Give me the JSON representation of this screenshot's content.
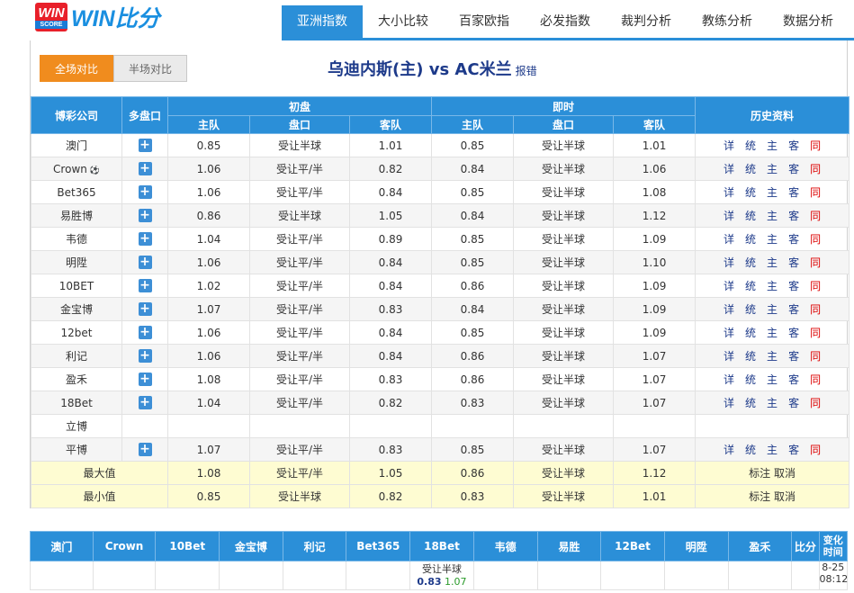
{
  "logo": {
    "box_top": "WIN",
    "box_bottom": "SCORE",
    "text": "WIN比分"
  },
  "nav": {
    "items": [
      "亚洲指数",
      "大小比较",
      "百家欧指",
      "必发指数",
      "裁判分析",
      "教练分析",
      "数据分析"
    ],
    "active_index": 0
  },
  "toggle": {
    "full": "全场对比",
    "half": "半场对比"
  },
  "match": {
    "title": "乌迪内斯(主) vs AC米兰",
    "report": "报错"
  },
  "table": {
    "headers": {
      "company": "博彩公司",
      "multi": "多盘口",
      "initial": "初盘",
      "live": "即时",
      "history": "历史资料",
      "home": "主队",
      "line": "盘口",
      "away": "客队"
    },
    "history_links": [
      "详",
      "统",
      "主",
      "客",
      "同"
    ],
    "rows": [
      {
        "company": "澳门",
        "plus": true,
        "i_home": "0.85",
        "i_line": "受让半球",
        "i_away": "1.01",
        "l_home": "0.85",
        "l_line": "受让半球",
        "l_away": "1.01"
      },
      {
        "company": "Crown",
        "soccer": true,
        "plus": true,
        "i_home": "1.06",
        "i_line": "受让平/半",
        "i_away": "0.82",
        "l_home": "0.84",
        "l_line": "受让半球",
        "l_away": "1.06"
      },
      {
        "company": "Bet365",
        "plus": true,
        "i_home": "1.06",
        "i_line": "受让平/半",
        "i_away": "0.84",
        "l_home": "0.85",
        "l_line": "受让半球",
        "l_away": "1.08"
      },
      {
        "company": "易胜博",
        "plus": true,
        "i_home": "0.86",
        "i_line": "受让半球",
        "i_away": "1.05",
        "l_home": "0.84",
        "l_line": "受让半球",
        "l_away": "1.12"
      },
      {
        "company": "韦德",
        "plus": true,
        "i_home": "1.04",
        "i_line": "受让平/半",
        "i_away": "0.89",
        "l_home": "0.85",
        "l_line": "受让半球",
        "l_away": "1.09"
      },
      {
        "company": "明陞",
        "plus": true,
        "i_home": "1.06",
        "i_line": "受让平/半",
        "i_away": "0.84",
        "l_home": "0.85",
        "l_line": "受让半球",
        "l_away": "1.10"
      },
      {
        "company": "10BET",
        "plus": true,
        "i_home": "1.02",
        "i_line": "受让平/半",
        "i_away": "0.84",
        "l_home": "0.86",
        "l_line": "受让半球",
        "l_away": "1.09"
      },
      {
        "company": "金宝博",
        "plus": true,
        "i_home": "1.07",
        "i_line": "受让平/半",
        "i_away": "0.83",
        "l_home": "0.84",
        "l_line": "受让半球",
        "l_away": "1.09"
      },
      {
        "company": "12bet",
        "plus": true,
        "i_home": "1.06",
        "i_line": "受让平/半",
        "i_away": "0.84",
        "l_home": "0.85",
        "l_line": "受让半球",
        "l_away": "1.09"
      },
      {
        "company": "利记",
        "plus": true,
        "i_home": "1.06",
        "i_line": "受让平/半",
        "i_away": "0.84",
        "l_home": "0.86",
        "l_line": "受让半球",
        "l_away": "1.07"
      },
      {
        "company": "盈禾",
        "plus": true,
        "i_home": "1.08",
        "i_line": "受让平/半",
        "i_away": "0.83",
        "l_home": "0.86",
        "l_line": "受让半球",
        "l_away": "1.07"
      },
      {
        "company": "18Bet",
        "plus": true,
        "i_home": "1.04",
        "i_line": "受让平/半",
        "i_away": "0.82",
        "l_home": "0.83",
        "l_line": "受让半球",
        "l_away": "1.07"
      },
      {
        "company": "立博",
        "plus": false,
        "empty": true,
        "i_home": "",
        "i_line": "",
        "i_away": "",
        "l_home": "",
        "l_line": "",
        "l_away": ""
      },
      {
        "company": "平博",
        "plus": true,
        "i_home": "1.07",
        "i_line": "受让平/半",
        "i_away": "0.83",
        "l_home": "0.85",
        "l_line": "受让半球",
        "l_away": "1.07"
      }
    ],
    "max": {
      "label": "最大值",
      "i_home": "1.08",
      "i_line": "受让平/半",
      "i_away": "1.05",
      "l_home": "0.86",
      "l_line": "受让半球",
      "l_away": "1.12",
      "action": "标注 取消"
    },
    "min": {
      "label": "最小值",
      "i_home": "0.85",
      "i_line": "受让半球",
      "i_away": "0.82",
      "l_home": "0.83",
      "l_line": "受让半球",
      "l_away": "1.01",
      "action": "标注 取消"
    }
  },
  "bottom": {
    "headers": [
      "澳门",
      "Crown",
      "10Bet",
      "金宝博",
      "利记",
      "Bet365",
      "18Bet",
      "韦德",
      "易胜",
      "12Bet",
      "明陞",
      "盈禾",
      "比分",
      "变化时间"
    ],
    "row": {
      "col18_line": "受让半球",
      "col18_h": "0.83",
      "col18_a": "1.07",
      "time_date": "8-25",
      "time_clock": "08:12"
    }
  }
}
